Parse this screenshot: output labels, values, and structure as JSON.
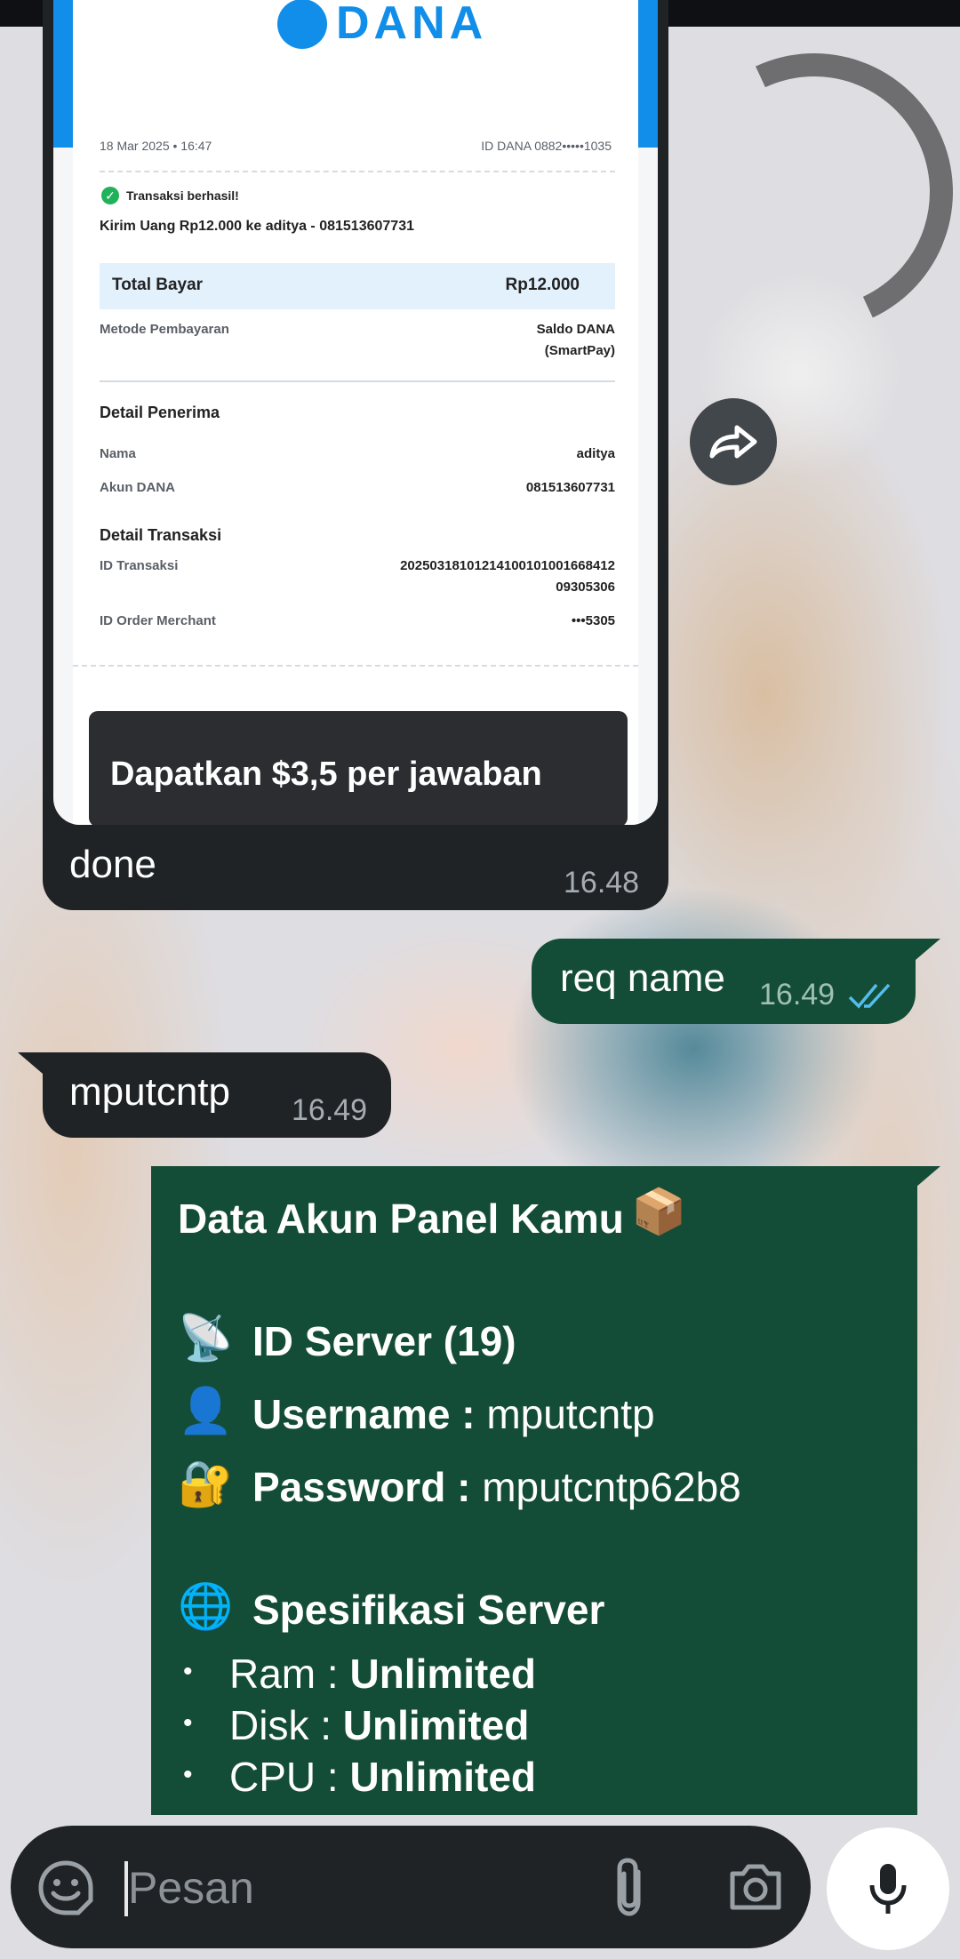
{
  "receipt": {
    "brand": "DANA",
    "datetime": "18 Mar 2025 • 16:47",
    "account_id": "ID DANA 0882•••••1035",
    "status": "Transaksi berhasil!",
    "summary": "Kirim Uang Rp12.000 ke aditya - 081513607731",
    "total_label": "Total Bayar",
    "total_value": "Rp12.000",
    "payment_method_label": "Metode Pembayaran",
    "payment_method_value_1": "Saldo DANA",
    "payment_method_value_2": "(SmartPay)",
    "recipient_section": "Detail Penerima",
    "name_label": "Nama",
    "name_value": "aditya",
    "account_label": "Akun DANA",
    "account_value": "081513607731",
    "transaction_section": "Detail Transaksi",
    "trx_id_label": "ID Transaksi",
    "trx_id_value_1": "20250318101214100101001668412",
    "trx_id_value_2": "09305306",
    "order_label": "ID Order Merchant",
    "order_value": "•••5305",
    "promo_text": "Dapatkan $3,5 per jawaban"
  },
  "messages": [
    {
      "direction": "in",
      "text": "done",
      "time": "16.48"
    },
    {
      "direction": "out",
      "text": "req name",
      "time": "16.49",
      "status": "read"
    },
    {
      "direction": "in",
      "text": "mputcntp",
      "time": "16.49"
    }
  ],
  "panel_message": {
    "title": "Data Akun Panel Kamu",
    "server_id": "ID Server (19)",
    "username_label": "Username :",
    "username_value": " mputcntp",
    "password_label": "Password :",
    "password_value": " mputcntp62b8",
    "spec_title": "Spesifikasi Server",
    "specs": [
      {
        "label": "Ram : ",
        "value": "Unlimited"
      },
      {
        "label": "Disk : ",
        "value": "Unlimited"
      },
      {
        "label": "CPU : ",
        "value": "Unlimited"
      }
    ],
    "icons": [
      "box-emoji",
      "satellite-emoji",
      "user-emoji",
      "lock-key-emoji",
      "globe-emoji"
    ]
  },
  "composer": {
    "placeholder": "Pesan",
    "icons": [
      "sticker-icon",
      "attach-icon",
      "camera-icon",
      "mic-icon"
    ]
  },
  "colors": {
    "incoming_bubble": "#1f2326",
    "outgoing_bubble": "#144d37",
    "read_tick": "#53bdeb",
    "dana_blue": "#118ee9"
  }
}
